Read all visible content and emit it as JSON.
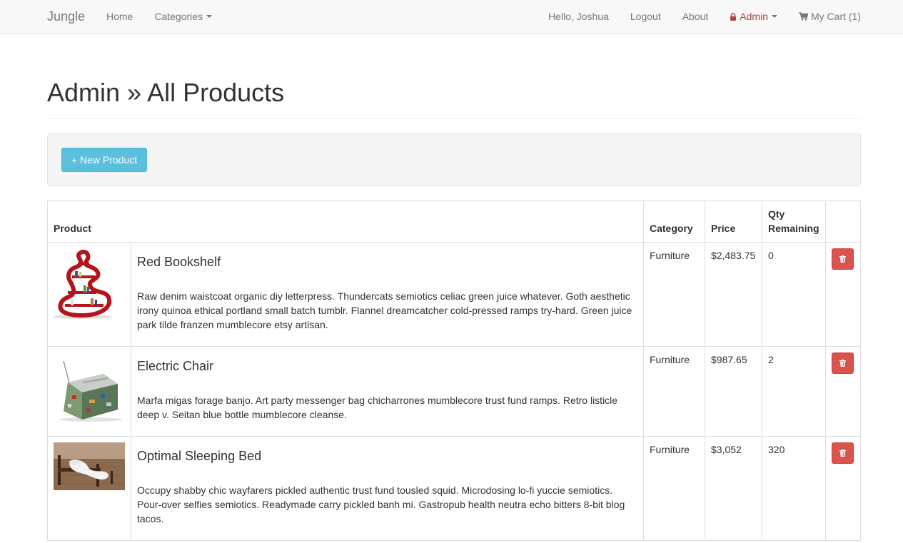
{
  "navbar": {
    "brand": "Jungle",
    "home": "Home",
    "categories": "Categories",
    "greeting": "Hello, Joshua",
    "logout": "Logout",
    "about": "About",
    "admin": "Admin",
    "cart": "My Cart (1)"
  },
  "page": {
    "title": "Admin » All Products"
  },
  "toolbar": {
    "new_product": "+ New Product"
  },
  "table": {
    "headers": {
      "product": "Product",
      "category": "Category",
      "price": "Price",
      "qty_line1": "Qty",
      "qty_line2": "Remaining"
    },
    "rows": [
      {
        "name": "Red Bookshelf",
        "description": "Raw denim waistcoat organic diy letterpress. Thundercats semiotics celiac green juice whatever. Goth aesthetic irony quinoa ethical portland small batch tumblr. Flannel dreamcatcher cold-pressed ramps try-hard. Green juice park tilde franzen mumblecore etsy artisan.",
        "category": "Furniture",
        "price": "$2,483.75",
        "qty": "0"
      },
      {
        "name": "Electric Chair",
        "description": "Marfa migas forage banjo. Art party messenger bag chicharrones mumblecore trust fund ramps. Retro listicle deep v. Seitan blue bottle mumblecore cleanse.",
        "category": "Furniture",
        "price": "$987.65",
        "qty": "2"
      },
      {
        "name": "Optimal Sleeping Bed",
        "description": "Occupy shabby chic wayfarers pickled authentic trust fund tousled squid. Microdosing lo-fi yuccie semiotics. Pour-over selfies semiotics. Readymade carry pickled banh mi. Gastropub health neutra echo bitters 8-bit blog tacos.",
        "category": "Furniture",
        "price": "$3,052",
        "qty": "320"
      }
    ]
  },
  "colors": {
    "danger": "#d9534f",
    "info": "#5bc0de",
    "admin_link": "#a94442"
  },
  "icons": {
    "lock": "lock-icon",
    "cart": "cart-icon",
    "trash": "trash-icon"
  }
}
